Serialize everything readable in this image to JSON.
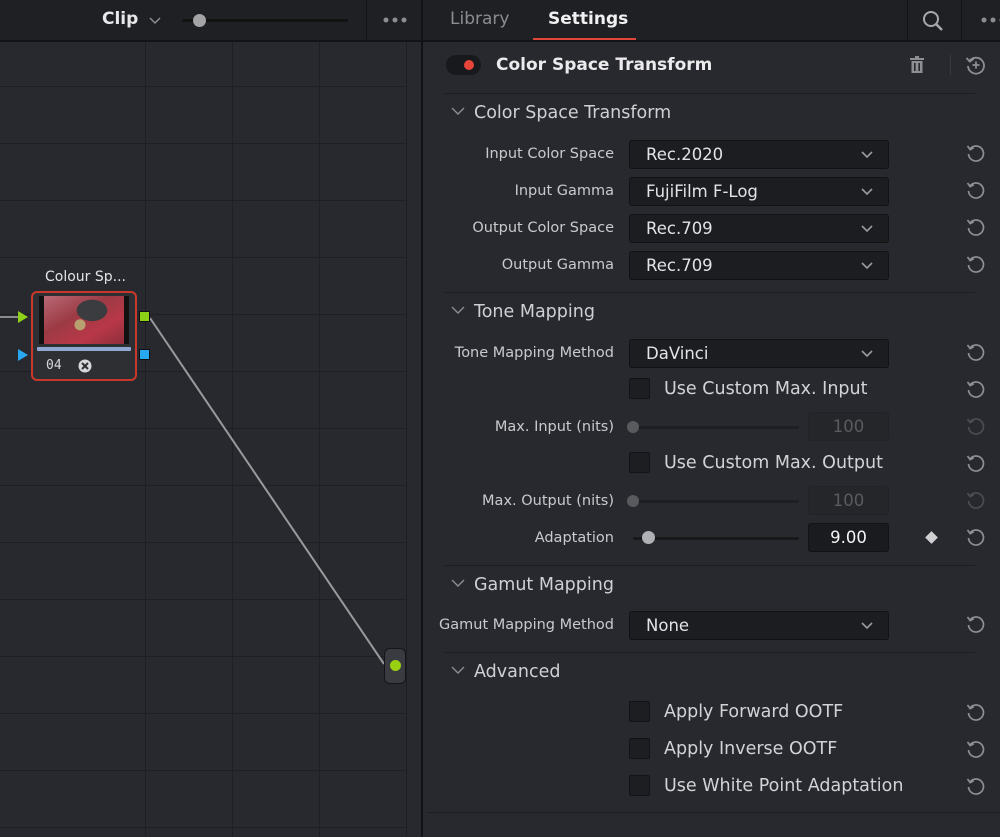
{
  "node_editor": {
    "mode_label": "Clip",
    "zoom_level": 0.1,
    "nodes": [
      {
        "title": "Colour Sp...",
        "number": "04",
        "thumbnail": "red-vehicle-closeup",
        "selected": true
      }
    ],
    "icons": {
      "mode_dropdown": "chevron-down-icon",
      "more": "more-horizontal-icon",
      "fx": "resolvefx-icon"
    },
    "colors": {
      "selected_border": "#c8382c",
      "rgb_port": "#8cd018",
      "alpha_port": "#28a8f0",
      "output_dot": "#9ad012"
    }
  },
  "inspector": {
    "tabs": [
      {
        "label": "Library",
        "active": false
      },
      {
        "label": "Settings",
        "active": true
      }
    ],
    "accent": "#e0463a",
    "effect": {
      "title": "Color Space Transform",
      "enabled": true,
      "icons": {
        "delete": "trash-icon",
        "reset_all": "reset-all-icon",
        "search": "search-icon",
        "more": "more-horizontal-icon"
      }
    },
    "sections": {
      "cst": {
        "title": "Color Space Transform",
        "fields": [
          {
            "label": "Input Color Space",
            "value": "Rec.2020"
          },
          {
            "label": "Input Gamma",
            "value": "FujiFilm F-Log"
          },
          {
            "label": "Output Color Space",
            "value": "Rec.709"
          },
          {
            "label": "Output Gamma",
            "value": "Rec.709"
          }
        ]
      },
      "tone": {
        "title": "Tone Mapping",
        "method_label": "Tone Mapping Method",
        "method_value": "DaVinci",
        "custom_input_label": "Use Custom Max. Input",
        "custom_input_checked": false,
        "max_input_label": "Max. Input (nits)",
        "max_input_value": "100",
        "max_input_fraction": 0.0,
        "custom_output_label": "Use Custom Max. Output",
        "custom_output_checked": false,
        "max_output_label": "Max. Output (nits)",
        "max_output_value": "100",
        "max_output_fraction": 0.0,
        "adaptation_label": "Adaptation",
        "adaptation_value": "9.00",
        "adaptation_fraction": 0.09
      },
      "gamut": {
        "title": "Gamut Mapping",
        "method_label": "Gamut Mapping Method",
        "method_value": "None"
      },
      "advanced": {
        "title": "Advanced",
        "options": [
          {
            "label": "Apply Forward OOTF",
            "checked": false
          },
          {
            "label": "Apply Inverse OOTF",
            "checked": false
          },
          {
            "label": "Use White Point Adaptation",
            "checked": false
          }
        ]
      }
    }
  }
}
